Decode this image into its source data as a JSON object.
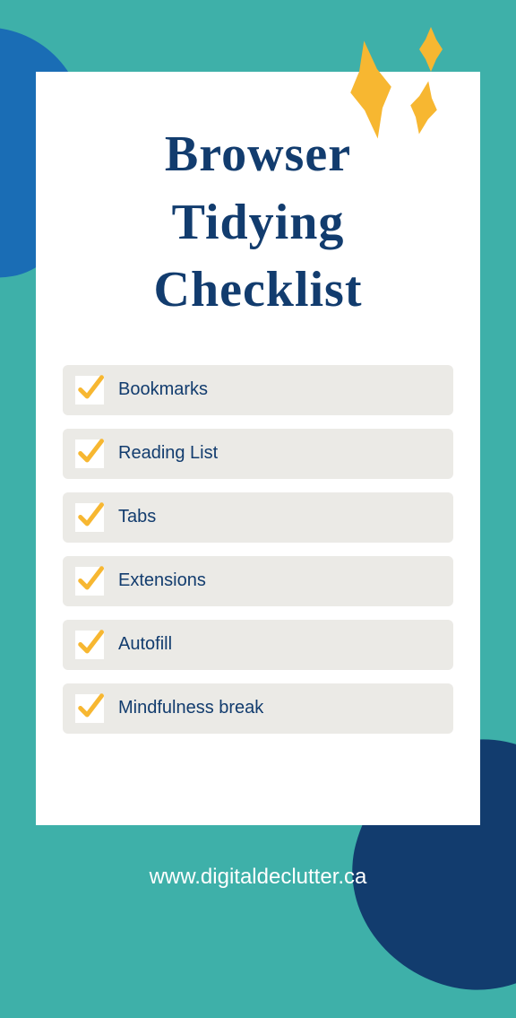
{
  "title_line1": "Browser",
  "title_line2": "Tidying",
  "title_line3": "Checklist",
  "checklist": {
    "items": [
      {
        "label": "Bookmarks",
        "checked": true
      },
      {
        "label": "Reading List",
        "checked": true
      },
      {
        "label": "Tabs",
        "checked": true
      },
      {
        "label": "Extensions",
        "checked": true
      },
      {
        "label": "Autofill",
        "checked": true
      },
      {
        "label": "Mindfulness break",
        "checked": true
      }
    ]
  },
  "footer": {
    "url": "www.digitaldeclutter.ca"
  },
  "colors": {
    "background": "#3eb0a9",
    "blob_blue": "#1a6db5",
    "blob_navy": "#123c6e",
    "title_navy": "#123c6e",
    "sparkle_gold": "#f7b731",
    "item_bg": "#ebeae6"
  }
}
